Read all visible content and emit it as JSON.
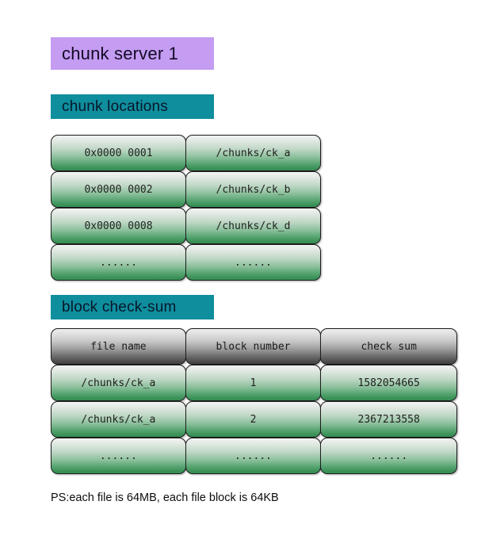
{
  "page": {
    "title": "chunk server 1",
    "footnote": "PS:each file is 64MB, each file block is 64KB"
  },
  "colors": {
    "title_banner_bg": "#c49cf2",
    "section_banner_bg": "#0f8e9d",
    "cell_green_top": "#f2f4f2",
    "cell_green_bottom": "#359055",
    "header_gray_top": "#ededed",
    "header_gray_bottom": "#434343",
    "cell_border": "#1d1d1d",
    "text": "#20211f",
    "page_bg": "#ffffff"
  },
  "sections": {
    "chunk_locations": {
      "label": "chunk locations",
      "rows": [
        {
          "handle": "0x0000 0001",
          "path": "/chunks/ck_a"
        },
        {
          "handle": "0x0000 0002",
          "path": "/chunks/ck_b"
        },
        {
          "handle": "0x0000 0008",
          "path": "/chunks/ck_d"
        },
        {
          "handle": "......",
          "path": "......"
        }
      ]
    },
    "block_checksum": {
      "label": "block check-sum",
      "headers": {
        "file_name": "file name",
        "block_number": "block number",
        "check_sum": "check sum"
      },
      "rows": [
        {
          "file_name": "/chunks/ck_a",
          "block_number": "1",
          "check_sum": "1582054665"
        },
        {
          "file_name": "/chunks/ck_a",
          "block_number": "2",
          "check_sum": "2367213558"
        },
        {
          "file_name": "......",
          "block_number": "......",
          "check_sum": "......"
        }
      ]
    }
  }
}
